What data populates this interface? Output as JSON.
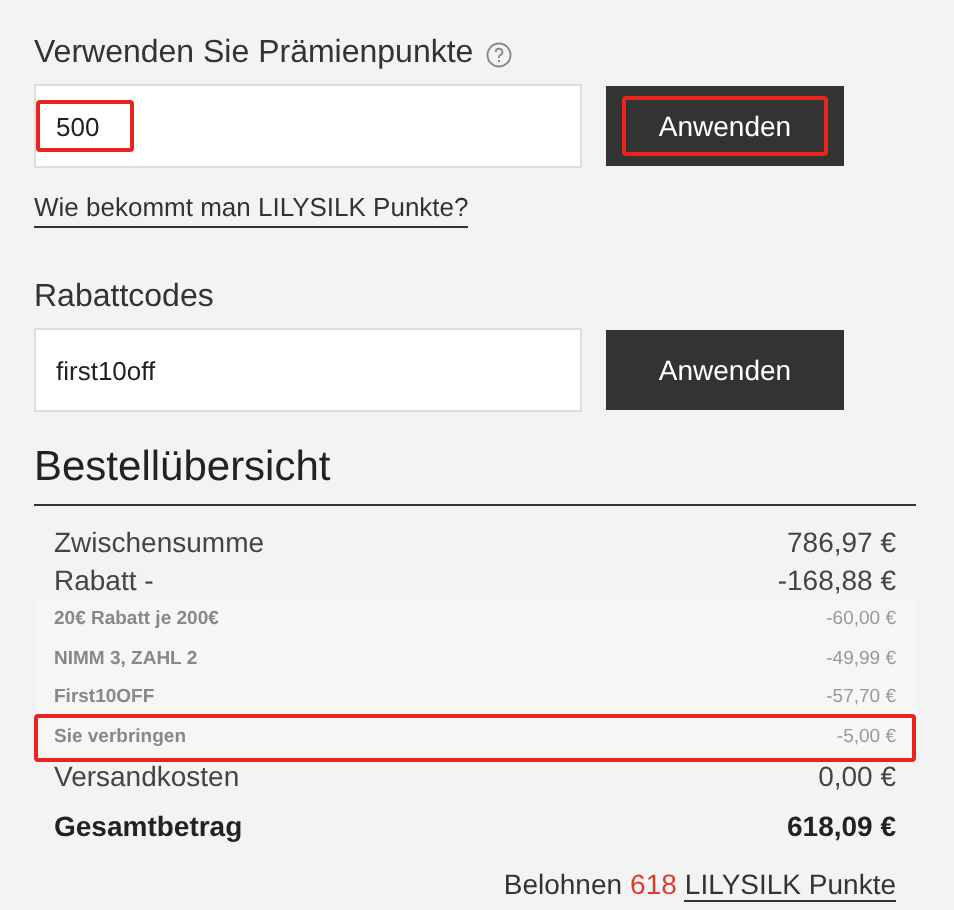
{
  "points": {
    "title": "Verwenden Sie Prämienpunkte",
    "help_icon": true,
    "value": "500",
    "value_highlighted": true,
    "button": "Anwenden",
    "button_highlighted": true,
    "link": "Wie bekommt man LILYSILK Punkte?"
  },
  "coupon": {
    "title": "Rabattcodes",
    "value": "first10off",
    "button": "Anwenden"
  },
  "summary": {
    "title": "Bestellübersicht",
    "rows": [
      {
        "kind": "main",
        "label": "Zwischensumme",
        "value": "786,97 €",
        "highlighted": false
      },
      {
        "kind": "main",
        "label": "Rabatt -",
        "value": "-168,88 €",
        "highlighted": false
      },
      {
        "kind": "sub",
        "label": "20€ Rabatt je 200€",
        "value": "-60,00 €",
        "highlighted": false
      },
      {
        "kind": "sub",
        "label": "NIMM 3, ZAHL 2",
        "value": "-49,99 €",
        "highlighted": false
      },
      {
        "kind": "sub",
        "label": "First10OFF",
        "value": "-57,70 €",
        "highlighted": false
      },
      {
        "kind": "sub",
        "label": "Sie verbringen",
        "value": "-5,00 €",
        "highlighted": true
      },
      {
        "kind": "main",
        "label": "Versandkosten",
        "value": "0,00 €",
        "highlighted": false
      },
      {
        "kind": "total",
        "label": "Gesamtbetrag",
        "value": "618,09 €",
        "highlighted": false
      }
    ],
    "reward": {
      "prefix": "Belohnen",
      "points": "618",
      "link": "LILYSILK Punkte"
    }
  }
}
